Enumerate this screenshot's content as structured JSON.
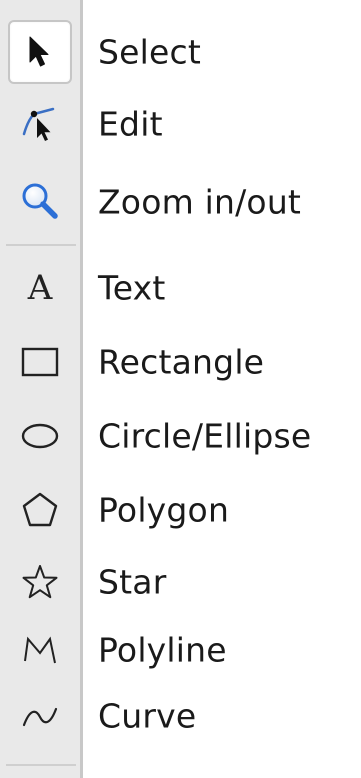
{
  "toolbar": {
    "selected": "select",
    "tools": [
      {
        "id": "select",
        "label": "Select",
        "icon": "arrow-cursor-icon"
      },
      {
        "id": "edit",
        "label": "Edit",
        "icon": "edit-path-icon"
      },
      {
        "id": "zoom",
        "label": "Zoom in/out",
        "icon": "magnifier-icon"
      },
      {
        "id": "text",
        "label": "Text",
        "icon": "text-a-icon"
      },
      {
        "id": "rectangle",
        "label": "Rectangle",
        "icon": "rectangle-icon"
      },
      {
        "id": "ellipse",
        "label": "Circle/Ellipse",
        "icon": "ellipse-icon"
      },
      {
        "id": "polygon",
        "label": "Polygon",
        "icon": "pentagon-icon"
      },
      {
        "id": "star",
        "label": "Star",
        "icon": "star-icon"
      },
      {
        "id": "polyline",
        "label": "Polyline",
        "icon": "polyline-icon"
      },
      {
        "id": "curve",
        "label": "Curve",
        "icon": "curve-icon"
      }
    ],
    "text_icon_glyph": "A",
    "colors": {
      "strip": "#e9e9e9",
      "zoom_blue": "#2c6fd6",
      "edit_blue": "#3a6fc4"
    }
  }
}
